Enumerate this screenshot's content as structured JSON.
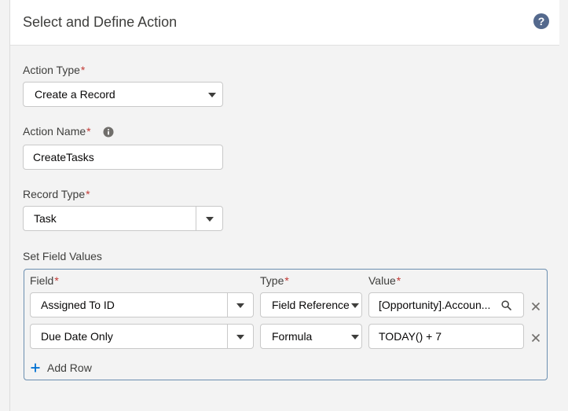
{
  "header": {
    "title": "Select and Define Action",
    "help_icon": "question-circle-icon"
  },
  "action_type": {
    "label": "Action Type",
    "required_mark": "*",
    "value": "Create a Record"
  },
  "action_name": {
    "label": "Action Name",
    "required_mark": "*",
    "value": "CreateTasks",
    "info_icon": "info-icon"
  },
  "record_type": {
    "label": "Record Type",
    "required_mark": "*",
    "value": "Task"
  },
  "field_values": {
    "label": "Set Field Values",
    "columns": {
      "field": {
        "label": "Field",
        "required_mark": "*"
      },
      "type": {
        "label": "Type",
        "required_mark": "*"
      },
      "value": {
        "label": "Value",
        "required_mark": "*"
      }
    },
    "rows": [
      {
        "field": "Assigned To ID",
        "type": "Field Reference",
        "value": "[Opportunity].Accoun..."
      },
      {
        "field": "Due Date Only",
        "type": "Formula",
        "value": "TODAY() + 7"
      }
    ],
    "add_row": "Add Row"
  },
  "colors": {
    "required": "#c23934",
    "box_border": "#6b8eb0",
    "accent": "#0070d2"
  }
}
